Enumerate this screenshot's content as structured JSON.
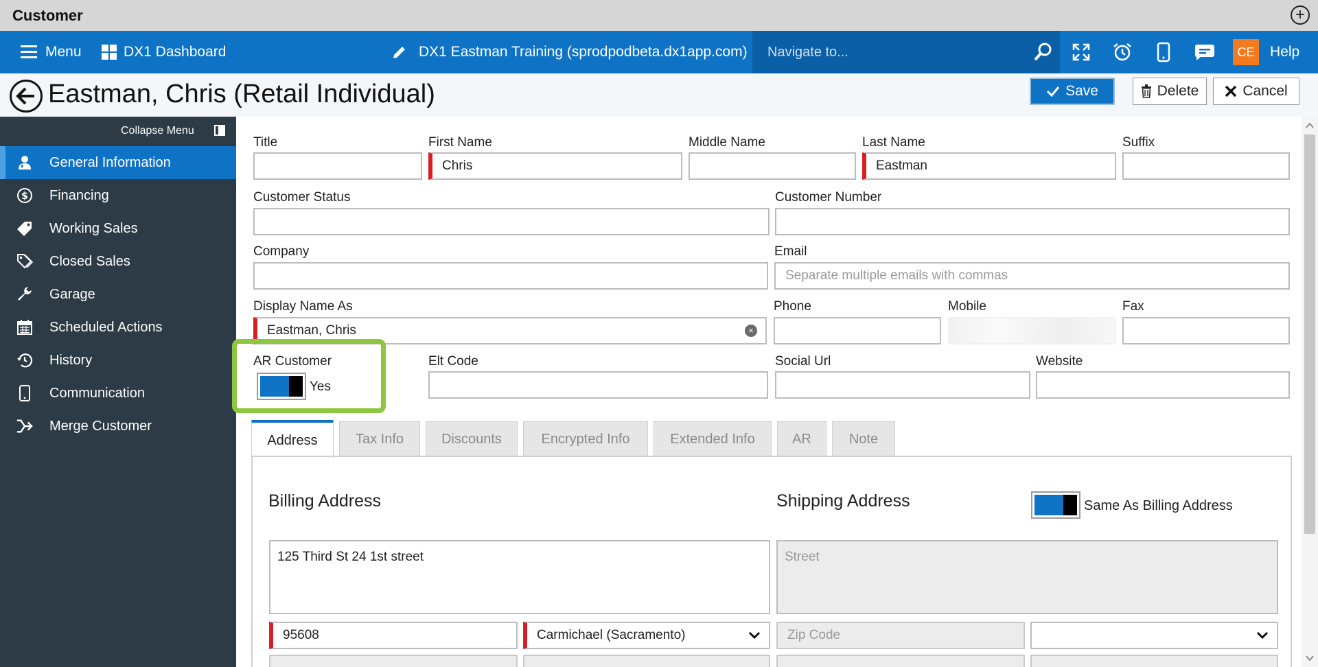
{
  "window": {
    "title": "Customer"
  },
  "nav": {
    "menu": "Menu",
    "dashboard": "DX1 Dashboard",
    "site": "DX1 Eastman Training (sprodpodbeta.dx1app.com)",
    "search_placeholder": "Navigate to...",
    "user_initials": "CE",
    "help": "Help"
  },
  "header": {
    "title": "Eastman, Chris (Retail Individual)",
    "save": "Save",
    "delete": "Delete",
    "cancel": "Cancel"
  },
  "sidebar": {
    "collapse": "Collapse Menu",
    "items": [
      {
        "label": "General Information",
        "icon": "person-icon",
        "active": true
      },
      {
        "label": "Financing",
        "icon": "dollar-icon"
      },
      {
        "label": "Working Sales",
        "icon": "tag-icon"
      },
      {
        "label": "Closed Sales",
        "icon": "tags-icon"
      },
      {
        "label": "Garage",
        "icon": "wrench-icon"
      },
      {
        "label": "Scheduled Actions",
        "icon": "calendar-icon"
      },
      {
        "label": "History",
        "icon": "history-icon"
      },
      {
        "label": "Communication",
        "icon": "phone-icon"
      },
      {
        "label": "Merge Customer",
        "icon": "merge-icon"
      }
    ]
  },
  "form": {
    "title": {
      "label": "Title",
      "value": ""
    },
    "first_name": {
      "label": "First Name",
      "value": "Chris"
    },
    "middle_name": {
      "label": "Middle Name",
      "value": ""
    },
    "last_name": {
      "label": "Last Name",
      "value": "Eastman"
    },
    "suffix": {
      "label": "Suffix",
      "value": ""
    },
    "customer_status": {
      "label": "Customer Status",
      "value": ""
    },
    "customer_number": {
      "label": "Customer Number",
      "value": ""
    },
    "company": {
      "label": "Company",
      "value": ""
    },
    "email": {
      "label": "Email",
      "placeholder": "Separate multiple emails with commas"
    },
    "display_name": {
      "label": "Display Name As",
      "value": "Eastman, Chris"
    },
    "phone": {
      "label": "Phone",
      "value": ""
    },
    "mobile": {
      "label": "Mobile"
    },
    "fax": {
      "label": "Fax",
      "value": ""
    },
    "ar_customer": {
      "label": "AR Customer",
      "value": "Yes"
    },
    "elt_code": {
      "label": "Elt Code",
      "value": ""
    },
    "social_url": {
      "label": "Social Url",
      "value": ""
    },
    "website": {
      "label": "Website",
      "value": ""
    }
  },
  "tabs": [
    "Address",
    "Tax Info",
    "Discounts",
    "Encrypted Info",
    "Extended Info",
    "AR",
    "Note"
  ],
  "address": {
    "billing_title": "Billing Address",
    "shipping_title": "Shipping Address",
    "same_as_billing": "Same As Billing Address",
    "billing_street": "125 Third St 24 1st street",
    "billing_zip": "95608",
    "billing_city": "Carmichael (Sacramento)",
    "shipping_street_placeholder": "Street",
    "shipping_zip_placeholder": "Zip Code"
  },
  "colors": {
    "primary": "#0f73c5",
    "sidebar": "#2c3b45",
    "required": "#d91f26",
    "highlight": "#8dc63f",
    "user_badge": "#f47a20"
  }
}
